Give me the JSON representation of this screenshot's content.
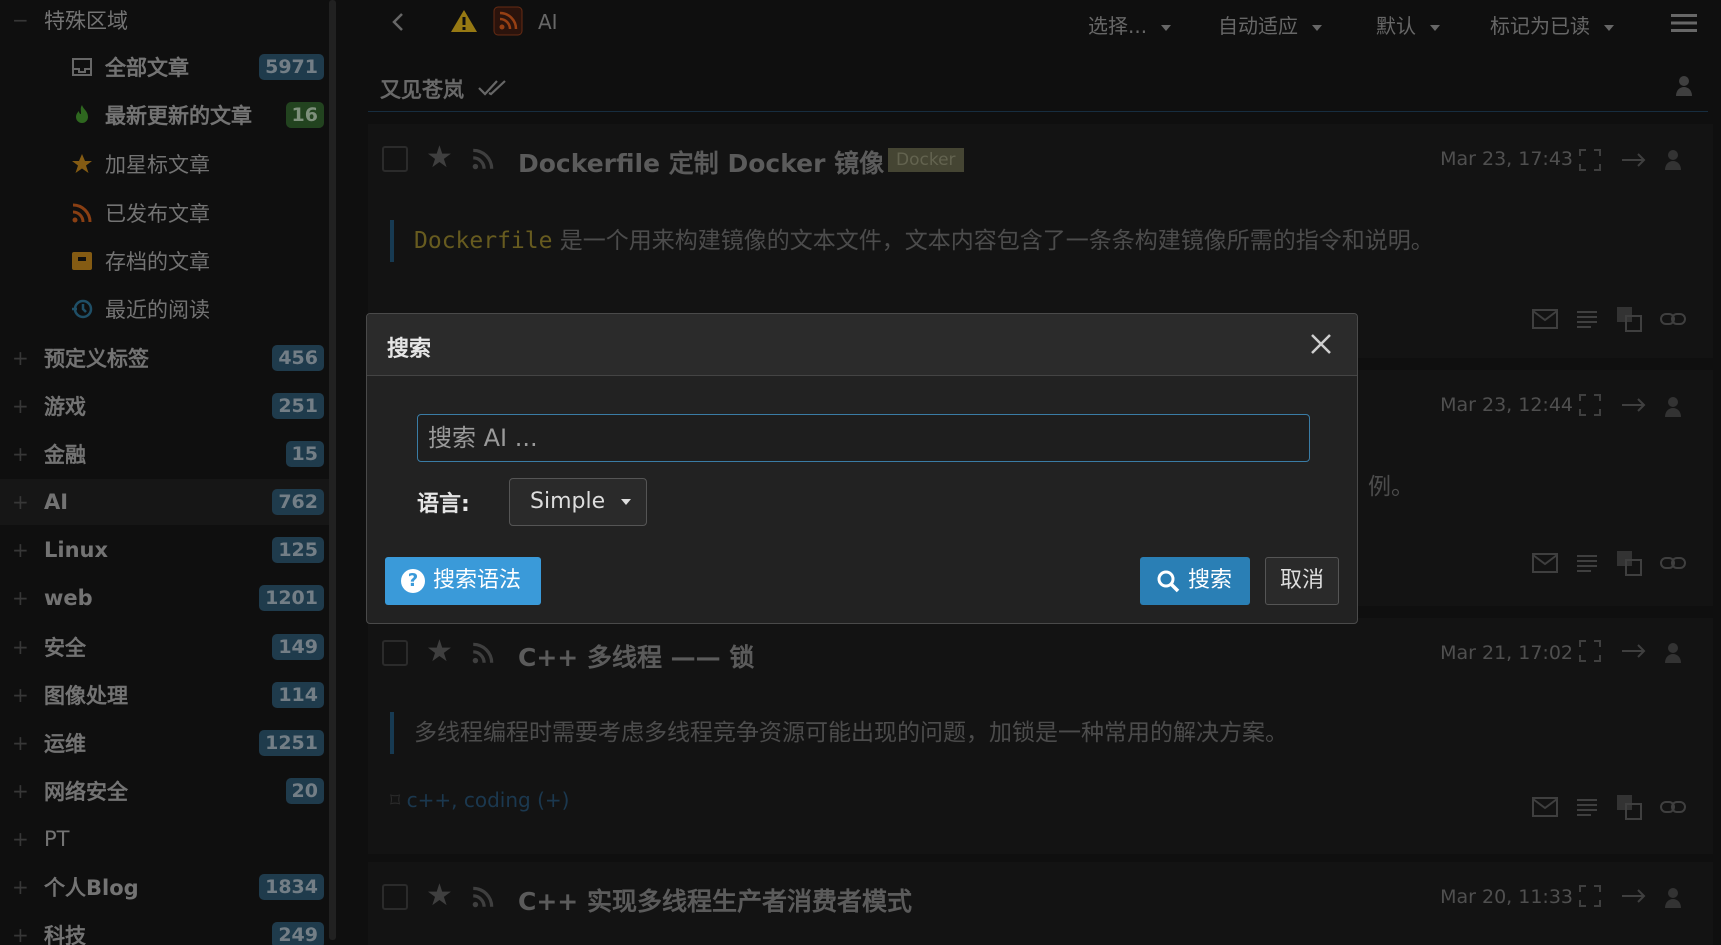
{
  "sidebar": {
    "special_area_label": "特殊区域",
    "special_items": [
      {
        "label": "全部文章",
        "count": "5971",
        "icon": "inbox-icon"
      },
      {
        "label": "最新更新的文章",
        "count": "16",
        "icon": "fire-icon"
      },
      {
        "label": "加星标文章",
        "count": "",
        "icon": "star-icon"
      },
      {
        "label": "已发布文章",
        "count": "",
        "icon": "rss-icon"
      },
      {
        "label": "存档的文章",
        "count": "",
        "icon": "archive-icon"
      },
      {
        "label": "最近的阅读",
        "count": "",
        "icon": "history-icon"
      }
    ],
    "categories": [
      {
        "label": "预定义标签",
        "count": "456"
      },
      {
        "label": "游戏",
        "count": "251"
      },
      {
        "label": "金融",
        "count": "15"
      },
      {
        "label": "AI",
        "count": "762"
      },
      {
        "label": "Linux",
        "count": "125"
      },
      {
        "label": "web",
        "count": "1201"
      },
      {
        "label": "安全",
        "count": "149"
      },
      {
        "label": "图像处理",
        "count": "114"
      },
      {
        "label": "运维",
        "count": "1251"
      },
      {
        "label": "网络安全",
        "count": "20"
      },
      {
        "label": "PT",
        "count": ""
      },
      {
        "label": "个人Blog",
        "count": "1834"
      },
      {
        "label": "科技",
        "count": "249"
      }
    ]
  },
  "topbar": {
    "feed_title": "AI",
    "select_label": "选择...",
    "fit_label": "自动适应",
    "order_label": "默认",
    "mark_read_label": "标记为已读"
  },
  "list": {
    "header_title": "又见苍岚"
  },
  "articles": [
    {
      "title": "Dockerfile 定制 Docker 镜像",
      "tag": "Docker",
      "date": "Mar 23, 17:43",
      "summary_code": "Dockerfile",
      "summary": " 是一个用来构建镜像的文本文件，文本内容包含了一条条构建镜像所需的指令和说明。",
      "tags": ""
    },
    {
      "title": "",
      "tag": "",
      "date": "Mar 23, 12:44",
      "summary_code": "",
      "summary": "例。",
      "tags": ""
    },
    {
      "title": "C++ 多线程 —— 锁",
      "tag": "",
      "date": "Mar 21, 17:02",
      "summary_code": "",
      "summary": "多线程编程时需要考虑多线程竞争资源可能出现的问题，加锁是一种常用的解决方案。",
      "tags": "c++, coding (+)"
    },
    {
      "title": "C++ 实现多线程生产者消费者模式",
      "tag": "",
      "date": "Mar 20, 11:33",
      "summary_code": "",
      "summary": "",
      "tags": ""
    }
  ],
  "dialog": {
    "title": "搜索",
    "search_placeholder": "搜索 AI ...",
    "language_label": "语言:",
    "language_value": "Simple",
    "help_button": "搜索语法",
    "search_button": "搜索",
    "cancel_button": "取消"
  }
}
